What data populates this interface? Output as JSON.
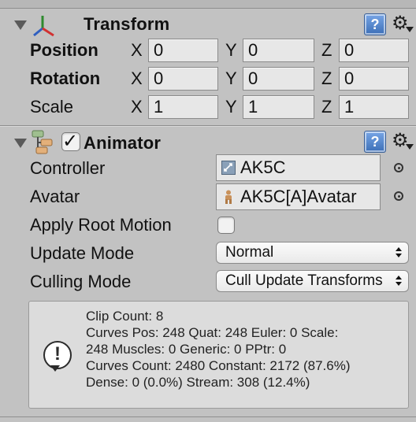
{
  "transform": {
    "title": "Transform",
    "rows": [
      {
        "label": "Position",
        "x": "0",
        "y": "0",
        "z": "0"
      },
      {
        "label": "Rotation",
        "x": "0",
        "y": "0",
        "z": "0"
      },
      {
        "label": "Scale",
        "x": "1",
        "y": "1",
        "z": "1"
      }
    ],
    "axes": {
      "x": "X",
      "y": "Y",
      "z": "Z"
    }
  },
  "animator": {
    "title": "Animator",
    "enabled": true,
    "controller": {
      "label": "Controller",
      "value": "AK5C"
    },
    "avatar": {
      "label": "Avatar",
      "value": "AK5C[A]Avatar"
    },
    "apply_root_motion": {
      "label": "Apply Root Motion",
      "checked": false
    },
    "update_mode": {
      "label": "Update Mode",
      "value": "Normal"
    },
    "culling_mode": {
      "label": "Culling Mode",
      "value": "Cull Update Transforms"
    },
    "info": {
      "lines": [
        "Clip Count: 8",
        "Curves Pos: 248 Quat: 248 Euler: 0 Scale:",
        "248 Muscles: 0 Generic: 0 PPtr: 0",
        "Curves Count: 2480 Constant: 2172 (87.6%)",
        "Dense: 0 (0.0%) Stream: 308 (12.4%)"
      ]
    }
  },
  "icons": {
    "help": "help-book-icon",
    "settings": "gear-icon",
    "transform": "transform-axes-icon",
    "animator": "animator-icon",
    "controller": "animator-controller-icon",
    "avatar": "avatar-icon",
    "info": "info-speech-icon",
    "picker": "object-picker-icon"
  },
  "help_glyph": "?",
  "gear_glyph": "⚙",
  "info_glyph": "!"
}
